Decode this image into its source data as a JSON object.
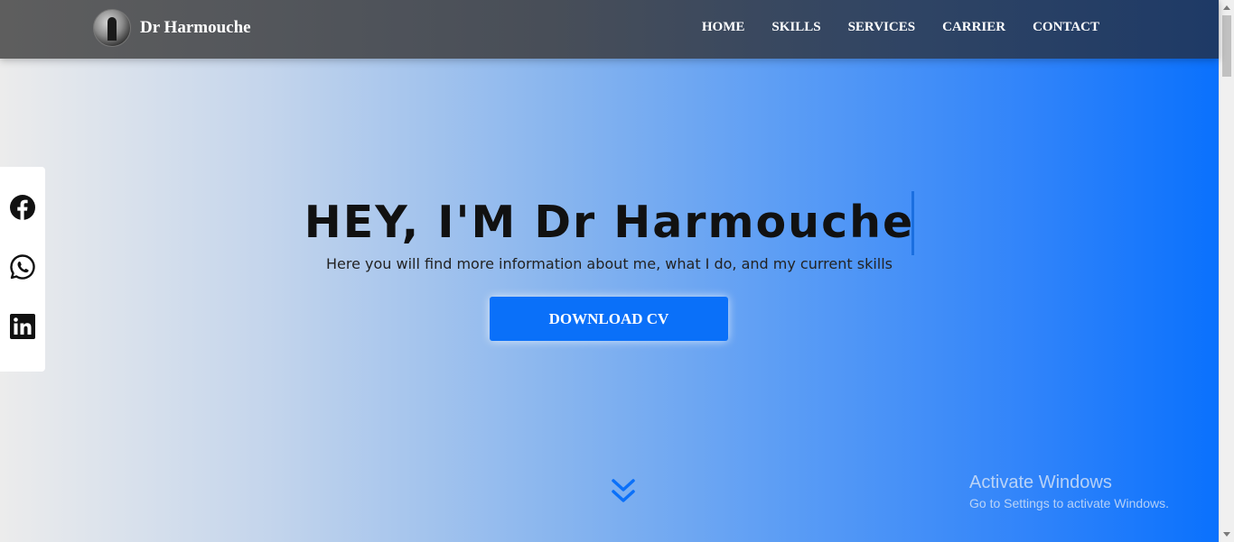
{
  "brand": {
    "name": "Dr Harmouche"
  },
  "nav": {
    "items": [
      {
        "label": "HOME"
      },
      {
        "label": "SKILLS"
      },
      {
        "label": "SERVICES"
      },
      {
        "label": "CARRIER"
      },
      {
        "label": "CONTACT"
      }
    ]
  },
  "social": {
    "links": [
      {
        "icon": "facebook-icon"
      },
      {
        "icon": "whatsapp-icon"
      },
      {
        "icon": "linkedin-icon"
      }
    ]
  },
  "hero": {
    "headline": "HEY, I'M Dr Harmouche",
    "subtitle": "Here you will find more information about me, what I do, and my current skills",
    "cta_label": "DOWNLOAD CV",
    "scroll_icon": "chevrons-down-icon"
  },
  "watermark": {
    "title": "Activate Windows",
    "subtitle": "Go to Settings to activate Windows."
  },
  "colors": {
    "accent": "#0a70f9",
    "navbar": "#2f4464",
    "headline": "#111111"
  }
}
